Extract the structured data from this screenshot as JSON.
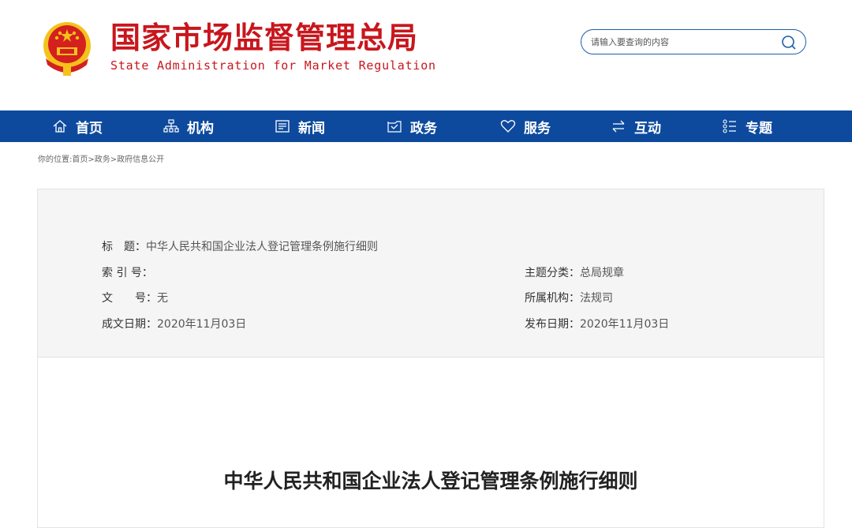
{
  "header": {
    "logo_cn": "国家市场监督管理总局",
    "logo_en": "State Administration for Market Regulation",
    "search_placeholder": "请输入要查询的内容"
  },
  "nav": [
    {
      "label": "首页",
      "icon": "home-icon"
    },
    {
      "label": "机构",
      "icon": "org-chart-icon"
    },
    {
      "label": "新闻",
      "icon": "news-icon"
    },
    {
      "label": "政务",
      "icon": "government-affairs-icon"
    },
    {
      "label": "服务",
      "icon": "heart-icon"
    },
    {
      "label": "互动",
      "icon": "exchange-arrows-icon"
    },
    {
      "label": "专题",
      "icon": "topics-list-icon"
    }
  ],
  "breadcrumb": {
    "prefix": "你的位置:",
    "items": [
      "首页",
      "政务",
      "政府信息公开"
    ],
    "sep": ">"
  },
  "meta": {
    "title_label": "标　题：",
    "title_value": "中华人民共和国企业法人登记管理条例施行细则",
    "index_label": "索 引 号：",
    "index_value": "",
    "docno_label": "文　　号：",
    "docno_value": "无",
    "date_label": "成文日期：",
    "date_value": "2020年11月03日",
    "category_label": "主题分类：",
    "category_value": "总局规章",
    "org_label": "所属机构：",
    "org_value": "法规司",
    "publish_label": "发布日期：",
    "publish_value": "2020年11月03日"
  },
  "document": {
    "title": "中华人民共和国企业法人登记管理条例施行细则"
  },
  "colors": {
    "brand_red": "#c8161d",
    "nav_blue": "#0d4a9e",
    "emblem_gold": "#f5c21b"
  }
}
